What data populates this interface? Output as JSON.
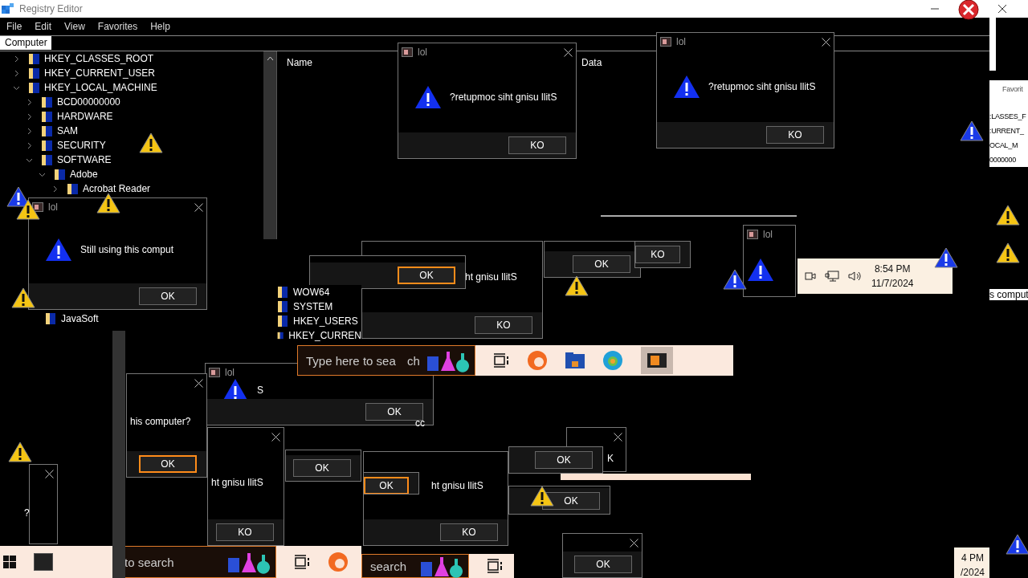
{
  "registry_editor": {
    "title": "Registry Editor",
    "menu": [
      "File",
      "Edit",
      "View",
      "Favorites",
      "Help"
    ],
    "address": "Computer",
    "columns": [
      "Name",
      "Data"
    ],
    "tree": [
      {
        "label": "HKEY_CLASSES_ROOT",
        "expanded": false
      },
      {
        "label": "HKEY_CURRENT_USER",
        "expanded": false
      },
      {
        "label": "HKEY_LOCAL_MACHINE",
        "expanded": true,
        "children": [
          {
            "label": "BCD00000000",
            "expanded": false
          },
          {
            "label": "HARDWARE",
            "expanded": false
          },
          {
            "label": "SAM",
            "expanded": false
          },
          {
            "label": "SECURITY",
            "expanded": false
          },
          {
            "label": "SOFTWARE",
            "expanded": true,
            "children": [
              {
                "label": "Adobe",
                "expanded": true,
                "children": [
                  {
                    "label": "Acrobat Reader",
                    "expanded": false
                  }
                ]
              }
            ]
          }
        ]
      }
    ]
  },
  "registry_fragments": [
    {
      "items": [
        "JavaSoft"
      ]
    },
    {
      "items": [
        "WOW64",
        "SYSTEM",
        "HKEY_USERS",
        "HKEY_CURREN"
      ]
    },
    {
      "menu": "Favorit",
      "items": [
        ":LASSES_F",
        ":URRENT_",
        "OCAL_M",
        "0000000"
      ]
    }
  ],
  "dialogs": [
    {
      "title": "lol",
      "close": true,
      "message": "?retupmoc siht gnisu llitS",
      "buttons": [
        {
          "label": "KO",
          "focused": false
        }
      ]
    },
    {
      "title": "lol",
      "close": true,
      "message": "?retupmoc siht gnisu llitS",
      "buttons": [
        {
          "label": "KO",
          "focused": false
        }
      ]
    },
    {
      "buttons": [
        {
          "label": "OK",
          "focused": false
        }
      ]
    },
    {
      "buttons": [
        {
          "label": "KO",
          "focused": false
        }
      ]
    },
    {
      "title": "lol"
    },
    {
      "buttons": [
        {
          "label": "OK",
          "focused": true
        }
      ]
    },
    {
      "message": "ht gnisu llitS",
      "buttons": [
        {
          "label": "KO",
          "focused": false
        }
      ]
    },
    {
      "title": "lol",
      "close": true,
      "message": "Still using this comput",
      "buttons": [
        {
          "label": "OK",
          "focused": false
        }
      ]
    },
    {
      "title": "lol",
      "message": "S",
      "buttons": [
        {
          "label": "OK",
          "focused": false
        }
      ]
    },
    {
      "close": true,
      "message": "his computer?",
      "buttons": [
        {
          "label": "OK",
          "focused": true
        }
      ]
    },
    {
      "close": true,
      "message": "ht gnisu llitS",
      "buttons": [
        {
          "label": "KO",
          "focused": false
        }
      ]
    },
    {
      "buttons": [
        {
          "label": "OK",
          "focused": false
        }
      ]
    },
    {
      "buttons": [
        {
          "label": "OK",
          "focused": true
        }
      ]
    },
    {
      "message": "ht gnisu llitS",
      "buttons": [
        {
          "label": "KO",
          "focused": false
        }
      ]
    },
    {
      "buttons": [
        {
          "label": "OK",
          "focused": false
        }
      ]
    },
    {
      "buttons": [
        {
          "label": "OK",
          "focused": false
        }
      ]
    },
    {
      "close": true,
      "message": "K"
    },
    {
      "close": true,
      "buttons": [
        {
          "label": "OK",
          "focused": false
        }
      ]
    },
    {
      "close": true
    }
  ],
  "taskbars": [
    {
      "placeholder": "Type here to sea",
      "tail": "ch"
    },
    {
      "placeholder": "to search"
    },
    {
      "placeholder": "search"
    }
  ],
  "clocks": [
    {
      "time": "8:54 PM",
      "date": "11/7/2024"
    },
    {
      "time": "4 PM",
      "date": "/2024"
    }
  ],
  "stray_texts": [
    "cc",
    "s comput",
    "?"
  ]
}
